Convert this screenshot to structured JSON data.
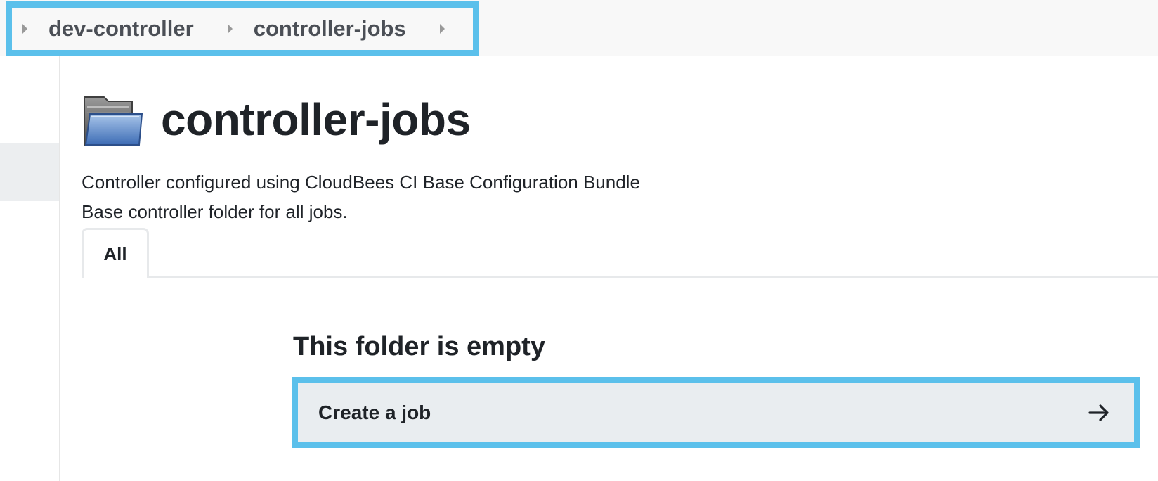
{
  "breadcrumb": {
    "items": [
      {
        "label": "dev-controller"
      },
      {
        "label": "controller-jobs"
      }
    ]
  },
  "page": {
    "title": "controller-jobs",
    "icon": "folder-icon",
    "description_lines": [
      "Controller configured using CloudBees CI Base Configuration Bundle",
      "Base controller folder for all jobs."
    ]
  },
  "tabs": [
    {
      "label": "All",
      "active": true
    }
  ],
  "empty_state": {
    "title": "This folder is empty",
    "action_label": "Create a job",
    "action_icon": "arrow-right-icon"
  },
  "colors": {
    "highlight_outline": "#5bc0eb",
    "action_background": "#e9edf0",
    "text": "#1f2328"
  }
}
